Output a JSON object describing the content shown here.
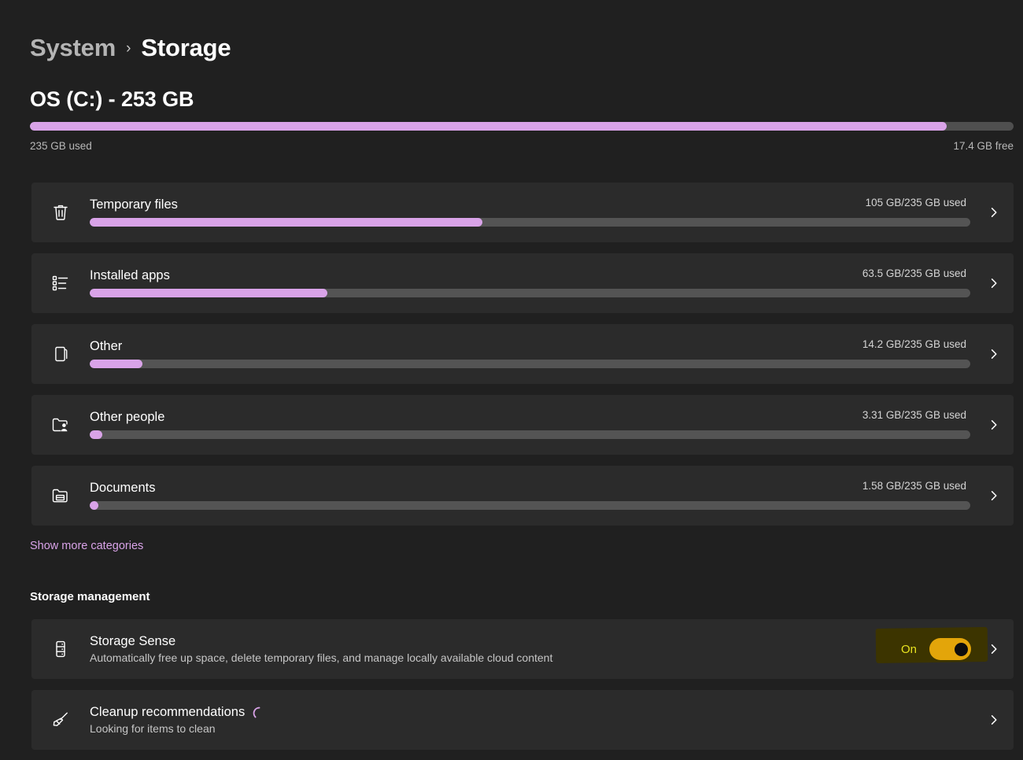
{
  "breadcrumb": {
    "parent": "System",
    "separator": "›",
    "current": "Storage"
  },
  "drive": {
    "title": "OS (C:) - 253 GB",
    "used_label": "235 GB used",
    "free_label": "17.4 GB free",
    "used_percent": 93.2,
    "bar_fill_color": "#d9a3e8",
    "bar_track_color": "#4f4f4f"
  },
  "categories": [
    {
      "icon": "trash-icon",
      "label": "Temporary files",
      "usage": "105 GB/235 GB used",
      "percent": 44.6
    },
    {
      "icon": "app-list-icon",
      "label": "Installed apps",
      "usage": "63.5 GB/235 GB used",
      "percent": 27.0
    },
    {
      "icon": "documents-stack-icon",
      "label": "Other",
      "usage": "14.2 GB/235 GB used",
      "percent": 6.0
    },
    {
      "icon": "other-people-icon",
      "label": "Other people",
      "usage": "3.31 GB/235 GB used",
      "percent": 1.4
    },
    {
      "icon": "documents-folder-icon",
      "label": "Documents",
      "usage": "1.58 GB/235 GB used",
      "percent": 0.7
    }
  ],
  "show_more": {
    "label": "Show more categories",
    "color": "#d9a3e8"
  },
  "storage_management": {
    "header": "Storage management",
    "items": [
      {
        "icon": "drive-stack-icon",
        "title": "Storage Sense",
        "subtitle": "Automatically free up space, delete temporary files, and manage locally available cloud content",
        "control": "toggle",
        "toggle_label": "On",
        "toggle_on": true,
        "toggle_color": "#e3a50a",
        "highlight_color": "#3c3400"
      },
      {
        "icon": "broom-icon",
        "title": "Cleanup recommendations",
        "subtitle": "Looking for items to clean",
        "control": "spinner",
        "spinner_color": "#d9a3e8"
      }
    ]
  }
}
